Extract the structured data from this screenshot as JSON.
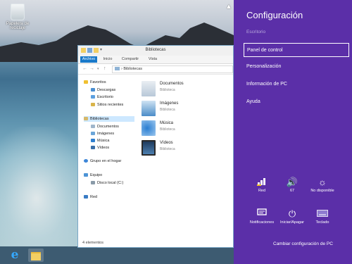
{
  "desktop": {
    "recycle_bin_label": "Papelera de reciclaje"
  },
  "taskbar": {
    "ie_glyph": "e",
    "items": [
      "internet-explorer",
      "file-explorer"
    ]
  },
  "explorer": {
    "title": "Bibliotecas",
    "ribbon_tabs": [
      {
        "label": "Archivo",
        "active": true
      },
      {
        "label": "Inicio",
        "active": false
      },
      {
        "label": "Compartir",
        "active": false
      },
      {
        "label": "Vista",
        "active": false
      }
    ],
    "address": "Bibliotecas",
    "nav": {
      "favorites_header": "Favoritos",
      "favorites": [
        "Descargas",
        "Escritorio",
        "Sitios recientes"
      ],
      "libraries_header": "Bibliotecas",
      "libraries": [
        "Documentos",
        "Imágenes",
        "Música",
        "Vídeos"
      ],
      "homegroup": "Grupo en el hogar",
      "computer_header": "Equipo",
      "computer_items": [
        "Disco local (C:)"
      ],
      "network": "Red"
    },
    "content": [
      {
        "name": "Documentos",
        "type": "Biblioteca"
      },
      {
        "name": "Imágenes",
        "type": "Biblioteca"
      },
      {
        "name": "Música",
        "type": "Biblioteca"
      },
      {
        "name": "Vídeos",
        "type": "Biblioteca"
      }
    ],
    "status": "4 elementos"
  },
  "settings_panel": {
    "title": "Configuración",
    "subtitle": "Escritorio",
    "items": [
      "Panel de control",
      "Personalización",
      "Información de PC",
      "Ayuda"
    ],
    "quick_settings": [
      {
        "label": "Red",
        "icon": "network-icon"
      },
      {
        "label": "67",
        "icon": "volume-icon"
      },
      {
        "label": "No disponible",
        "icon": "brightness-icon"
      },
      {
        "label": "Notificaciones",
        "icon": "notifications-icon"
      },
      {
        "label": "Iniciar/Apagar",
        "icon": "power-icon"
      },
      {
        "label": "Teclado",
        "icon": "keyboard-icon"
      }
    ],
    "footer": "Cambiar configuración de PC",
    "accent_color": "#5b2fa8"
  }
}
